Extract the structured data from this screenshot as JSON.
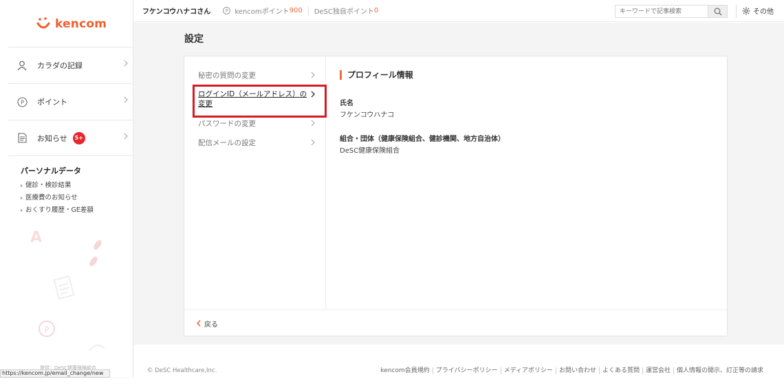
{
  "app": {
    "logo_text": "kencom",
    "brand_color": "#ef5f2f"
  },
  "sidebar": {
    "items": [
      {
        "label": "カラダの記録",
        "icon": "person-icon"
      },
      {
        "label": "ポイント",
        "icon": "point-icon"
      },
      {
        "label": "お知らせ",
        "icon": "document-icon",
        "badge": "5+"
      }
    ],
    "personal_data": {
      "title": "パーソナルデータ",
      "links": [
        "健診・検診結果",
        "医療費のお知らせ",
        "おくすり履歴・GE差額"
      ]
    },
    "provider": "提供：DeSC健康保険組合",
    "status_url": "https://kencom.jp/email_change/new"
  },
  "topbar": {
    "user_name": "フケンコウハナコさん",
    "kencom_point_label": "kencomポイント",
    "kencom_point_value": "900",
    "desc_point_label": "DeSC独自ポイント",
    "desc_point_value": "0",
    "search_placeholder": "キーワードで記事検索",
    "other_label": "その他"
  },
  "main": {
    "page_title": "設定",
    "menu": [
      {
        "label": "秘密の質問の変更"
      },
      {
        "label": "ログインID（メールアドレス）の変更",
        "active": true
      },
      {
        "label": "パスワードの変更"
      },
      {
        "label": "配信メールの設定"
      }
    ],
    "profile": {
      "section_title": "プロフィール情報",
      "name_label": "氏名",
      "name_value": "フケンコウハナコ",
      "org_label": "組合・団体（健康保険組合、健診機関、地方自治体）",
      "org_value": "DeSC健康保険組合"
    },
    "back_label": "戻る"
  },
  "footer": {
    "copyright": "© DeSC Healthcare,Inc.",
    "links": [
      "kencom会員規約",
      "プライバシーポリシー",
      "メディアポリシー",
      "お問い合わせ",
      "よくある質問",
      "運営会社",
      "個人情報の開示、訂正等の請求"
    ]
  }
}
